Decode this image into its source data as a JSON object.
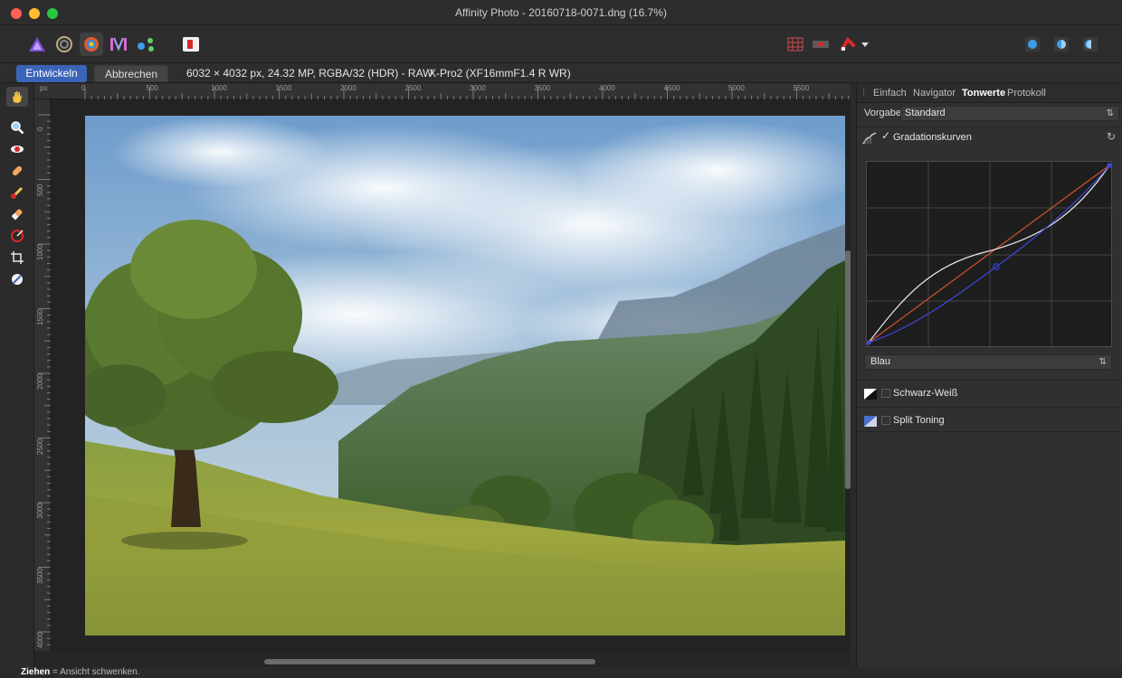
{
  "window": {
    "title": "Affinity Photo - 20160718-0071.dng (16.7%)"
  },
  "toolbar": {
    "personas": [
      "photo-persona-icon",
      "liquify-persona-icon",
      "develop-persona-icon",
      "tone-mapping-persona-icon",
      "export-persona-icon"
    ],
    "active_persona": "develop-persona-icon",
    "view_buttons": [
      "before-after-icon",
      "split-view-icon",
      "mirror-view-icon"
    ]
  },
  "context": {
    "develop_label": "Entwickeln",
    "cancel_label": "Abbrechen",
    "image_info": "6032 × 4032 px, 24.32 MP, RGBA/32 (HDR) - RAW",
    "camera_info": "X-Pro2 (XF16mmF1.4 R WR)"
  },
  "ruler": {
    "unit": "px",
    "top_ticks": [
      "0",
      "500",
      "1000",
      "1500",
      "2000",
      "2500",
      "3000",
      "3500",
      "4000",
      "4500",
      "5000",
      "5500"
    ],
    "left_ticks": [
      "0",
      "500",
      "1000",
      "1500",
      "2000",
      "2500",
      "3000",
      "3500",
      "4000"
    ]
  },
  "panel": {
    "tabs": [
      "Einfach",
      "Navigator",
      "Tonwerte",
      "Protokoll"
    ],
    "active_tab": "Tonwerte",
    "preset_label": "Vorgabe:",
    "preset_value": "Standard",
    "curves_title": "Gradationskurven",
    "curves_check": "✓",
    "channel_value": "Blau",
    "bw_title": "Schwarz-Weiß",
    "split_title": "Split Toning"
  },
  "status": {
    "key": "Ziehen",
    "text": " = Ansicht schwenken."
  },
  "colors": {
    "accent": "#3a64b8",
    "curve_white": "#e8e8e8",
    "curve_orange": "#d2532a",
    "curve_blue": "#3b48d6"
  }
}
